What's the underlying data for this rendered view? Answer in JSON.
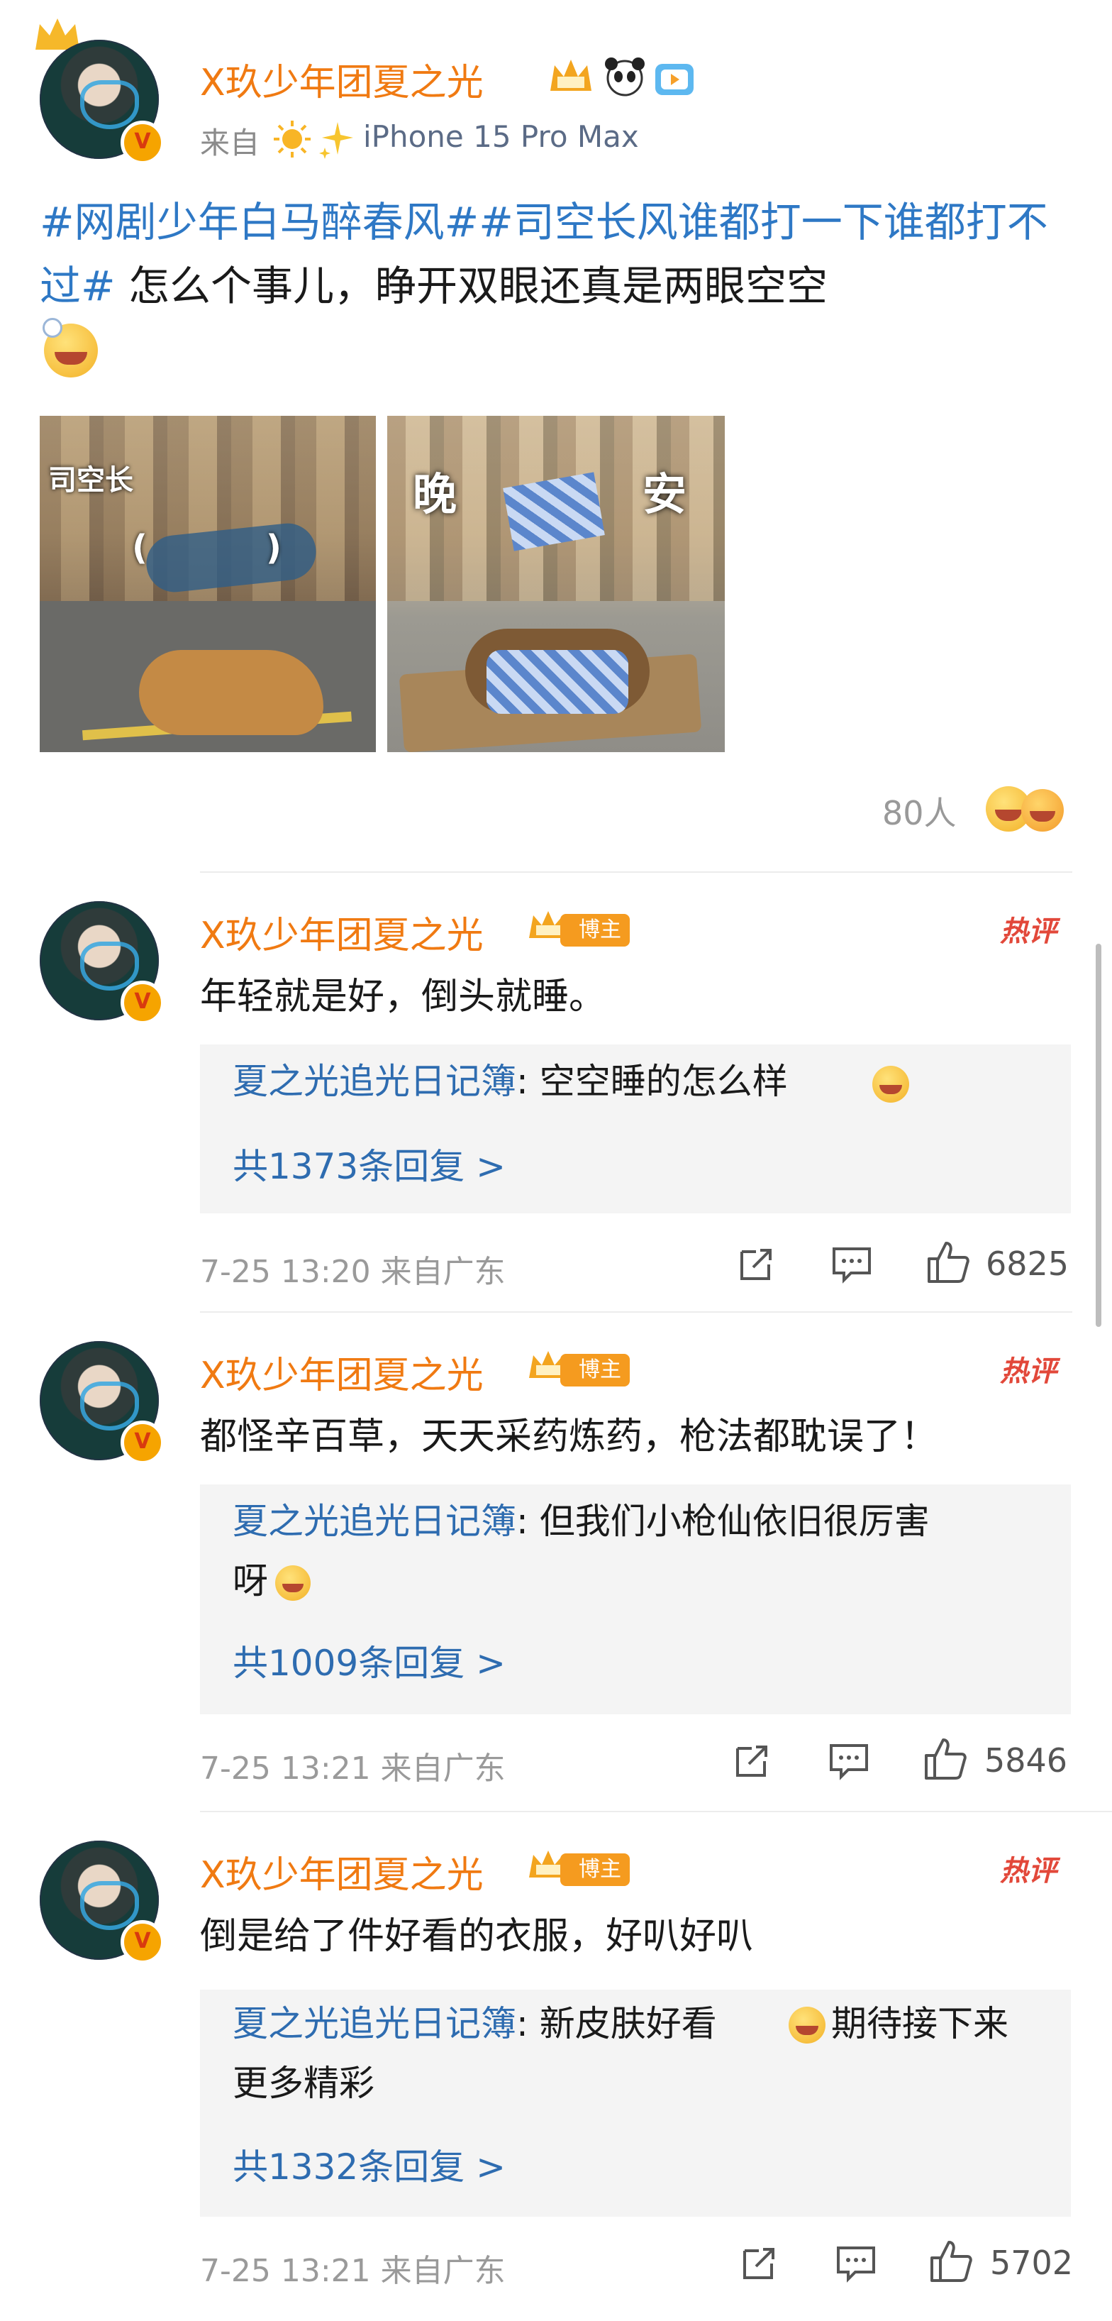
{
  "post": {
    "author": "X玖少年团夏之光",
    "source_prefix": "来自",
    "device": "iPhone 15 Pro Max",
    "topic1": "#网剧少年白马醉春风#",
    "topic2": "#司空长风谁都打一下谁都打不过#",
    "text": " 怎么个事儿，睁开双眼还真是两眼空空",
    "image1_caption": "司空长",
    "image1_brackets": "(          )",
    "image2_left": "晚",
    "image2_right": "安",
    "reaction_count": "80人"
  },
  "comments": [
    {
      "author": "X玖少年团夏之光",
      "badge": "博主",
      "hot": "热评",
      "text": "年轻就是好，倒头就睡。",
      "reply_name": "夏之光追光日记簿",
      "reply_text": ": 空空睡的怎么样",
      "reply_count": "共1373条回复 >",
      "time": "7-25 13:20  来自广东",
      "likes": "6825"
    },
    {
      "author": "X玖少年团夏之光",
      "badge": "博主",
      "hot": "热评",
      "text": "都怪辛百草，天天采药炼药，枪法都耽误了！",
      "reply_name": "夏之光追光日记簿",
      "reply_text": ": 但我们小枪仙依旧很厉害",
      "reply_text2": "呀",
      "reply_count": "共1009条回复 >",
      "time": "7-25 13:21  来自广东",
      "likes": "5846"
    },
    {
      "author": "X玖少年团夏之光",
      "badge": "博主",
      "hot": "热评",
      "text": "倒是给了件好看的衣服，好叭好叭",
      "reply_name": "夏之光追光日记簿",
      "reply_text": ": 新皮肤好看",
      "reply_text_b": "期待接下来",
      "reply_text2": "更多精彩",
      "reply_count": "共1332条回复 >",
      "time": "7-25 13:21  来自广东",
      "likes": "5702"
    }
  ],
  "colors": {
    "name": "#f07a12",
    "link": "#2e78c5",
    "hot": "#e2483a",
    "badge": "#f59b1f"
  },
  "icons": [
    "crown-icon",
    "panda-icon",
    "tv-icon",
    "sun-icon",
    "sparkle-icon",
    "share-icon",
    "comment-icon",
    "like-icon",
    "v-badge-icon"
  ]
}
